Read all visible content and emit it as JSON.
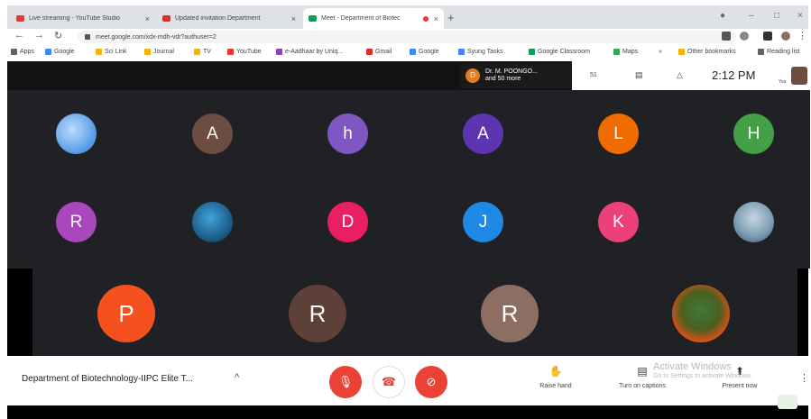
{
  "browser": {
    "tabs": [
      {
        "title": "Live streaming - YouTube Studio",
        "icon": "youtube-icon",
        "color": "#e53935"
      },
      {
        "title": "Updated invitation Department",
        "icon": "gmail-icon",
        "color": "#d93025"
      },
      {
        "title": "Meet - Department of Biotec",
        "icon": "meet-icon",
        "color": "#0f9d58"
      }
    ],
    "new_tab": "+",
    "url": "meet.google.com/xdx-mdh-vdr?authuser=2",
    "window_controls": [
      "–",
      "□",
      "×"
    ]
  },
  "bookmarks": [
    {
      "label": "Apps",
      "color": "#5f6368"
    },
    {
      "label": "Google",
      "color": "#4285f4"
    },
    {
      "label": "Sci Link",
      "color": "#f4b400"
    },
    {
      "label": "Journal",
      "color": "#f4b400"
    },
    {
      "label": "TV",
      "color": "#f4b400"
    },
    {
      "label": "YouTube",
      "color": "#e53935"
    },
    {
      "label": "e-Aadhaar by Uniq...",
      "color": "#8e44ad"
    },
    {
      "label": "Gmail",
      "color": "#d93025"
    },
    {
      "label": "Google",
      "color": "#4285f4"
    },
    {
      "label": "Syung Tasks",
      "color": "#4285f4"
    },
    {
      "label": "Google Classroom",
      "color": "#0f9d58"
    },
    {
      "label": "Maps",
      "color": "#34a853"
    },
    {
      "label": "»",
      "color": "#fff"
    },
    {
      "label": "Other bookmarks",
      "color": "#f4b400"
    },
    {
      "label": "Reading list",
      "color": "#5f6368"
    }
  ],
  "meet": {
    "participants_chip": {
      "initial": "D",
      "line1": "Dr. M. POONGO...",
      "line2": "and 50 more"
    },
    "top_tools": {
      "people_count": "51",
      "time": "2:12 PM",
      "you_label": "You"
    },
    "participants_upper": [
      {
        "label": "",
        "type": "photo-sky"
      },
      {
        "label": "A",
        "color": "#6d4c41"
      },
      {
        "label": "h",
        "color": "#7e57c2"
      },
      {
        "label": "A",
        "color": "#5e35b1"
      },
      {
        "label": "L",
        "color": "#ef6c00"
      },
      {
        "label": "H",
        "color": "#43a047"
      },
      {
        "label": "R",
        "color": "#ab47bc"
      },
      {
        "label": "",
        "type": "photo-globe"
      },
      {
        "label": "D",
        "color": "#e91e63"
      },
      {
        "label": "J",
        "color": "#1e88e5"
      },
      {
        "label": "K",
        "color": "#ec407a"
      },
      {
        "label": "",
        "type": "photo-person"
      }
    ],
    "participants_lower": [
      {
        "label": "P",
        "color": "#f4511e"
      },
      {
        "label": "R",
        "color": "#5d4037"
      },
      {
        "label": "R",
        "color": "#8d6e63"
      },
      {
        "label": "",
        "type": "photo-fire"
      }
    ]
  },
  "bottom_bar": {
    "meeting_title": "Department of Biotechnology-IIPC Elite T...",
    "chevron": "^",
    "controls": {
      "mic": "mic-off",
      "end": "end-call",
      "cam": "camera-off"
    },
    "tools": [
      {
        "label": "Raise hand",
        "glyph": "✋"
      },
      {
        "label": "Turn on captions",
        "glyph": "▤"
      },
      {
        "label": "Present now",
        "glyph": "⬆"
      }
    ],
    "watermark_line1": "Activate Windows",
    "watermark_line2": "Go to Settings to activate Windows.",
    "more": "⋮"
  }
}
